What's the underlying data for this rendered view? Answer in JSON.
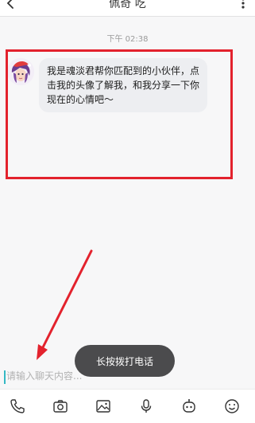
{
  "header": {
    "title": "佩奇 吃",
    "back_icon": "chevron-left-icon",
    "more_icon": "more-vertical-icon"
  },
  "chat": {
    "timestamp": "下午 02:38",
    "messages": [
      {
        "sender": "bot",
        "text": "我是魂淡君帮你匹配到的小伙伴，点击我的头像了解我，和我分享一下你现在的心情吧～"
      }
    ]
  },
  "toast": {
    "text": "长按拨打电话"
  },
  "input": {
    "placeholder": "请输入聊天内容..."
  },
  "toolbar": {
    "items": [
      {
        "icon": "phone-icon"
      },
      {
        "icon": "camera-icon"
      },
      {
        "icon": "image-icon"
      },
      {
        "icon": "microphone-icon"
      },
      {
        "icon": "robot-icon"
      },
      {
        "icon": "emoji-icon"
      }
    ]
  },
  "colors": {
    "highlight": "#e3222d",
    "arrow": "#e3222d",
    "toast_bg": "#4b4b4d",
    "bubble_bg": "#edeef1",
    "cursor": "#33b8c4"
  }
}
